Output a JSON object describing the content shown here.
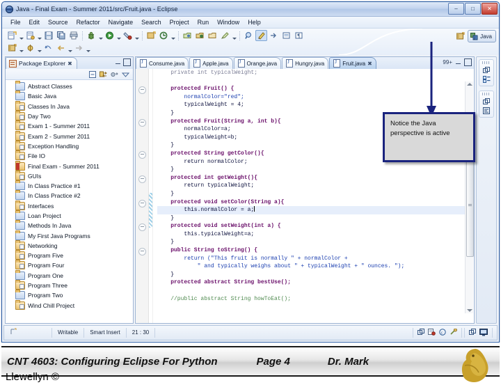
{
  "window": {
    "title": "Java - Final Exam - Summer 2011/src/Fruit.java - Eclipse",
    "logo_icon": "eclipse-logo-icon",
    "minimize_label": "–",
    "maximize_label": "□",
    "close_label": "✕"
  },
  "menubar": [
    {
      "label": "File"
    },
    {
      "label": "Edit"
    },
    {
      "label": "Source"
    },
    {
      "label": "Refactor"
    },
    {
      "label": "Navigate"
    },
    {
      "label": "Search"
    },
    {
      "label": "Project"
    },
    {
      "label": "Run"
    },
    {
      "label": "Window"
    },
    {
      "label": "Help"
    }
  ],
  "toolbar": {
    "row1": [
      {
        "name": "new-wizard-button",
        "glyph": "▤"
      },
      {
        "name": "new-wizard-dropdown",
        "glyph": "caret"
      },
      {
        "name": "new-java-class-button",
        "glyph": "▥"
      },
      {
        "name": "new-java-class-dropdown",
        "glyph": "caret"
      },
      {
        "name": "save-button",
        "glyph": "▣"
      },
      {
        "name": "save-all-button",
        "glyph": "▨"
      },
      {
        "name": "print-button",
        "glyph": "⎙"
      },
      {
        "name": "separator",
        "glyph": "sep"
      },
      {
        "name": "debug-button",
        "glyph": "☢"
      },
      {
        "name": "debug-dropdown",
        "glyph": "caret"
      },
      {
        "name": "run-button",
        "glyph": "▶"
      },
      {
        "name": "run-dropdown",
        "glyph": "caret"
      },
      {
        "name": "run-external-tools-button",
        "glyph": "⚒"
      },
      {
        "name": "run-external-tools-dropdown",
        "glyph": "caret"
      },
      {
        "name": "separator",
        "glyph": "sep"
      },
      {
        "name": "new-package-button",
        "glyph": "◫"
      },
      {
        "name": "open-type-button",
        "glyph": "Ⓖ"
      },
      {
        "name": "open-type-dropdown",
        "glyph": "caret"
      },
      {
        "name": "separator",
        "glyph": "sep"
      },
      {
        "name": "open-task-button",
        "glyph": "◗"
      },
      {
        "name": "new-task-button",
        "glyph": "◖"
      },
      {
        "name": "deactivate-task-button",
        "glyph": "◑"
      },
      {
        "name": "filter-task-button",
        "glyph": "✐"
      },
      {
        "name": "task-dropdown",
        "glyph": "caret"
      },
      {
        "name": "separator",
        "glyph": "sep"
      },
      {
        "name": "search-button",
        "glyph": "⊕"
      },
      {
        "name": "highlight-button",
        "glyph": "✎"
      },
      {
        "name": "next-annotation-button",
        "glyph": "➤"
      },
      {
        "name": "last-edit-button",
        "glyph": "▤"
      },
      {
        "name": "toggle-mark-button",
        "glyph": "¶"
      }
    ],
    "row2": [
      {
        "name": "open-perspective-button",
        "glyph": "⬚"
      },
      {
        "name": "open-perspective-dropdown",
        "glyph": "caret"
      },
      {
        "name": "toggle-breakpoint-button",
        "glyph": "⚲"
      },
      {
        "name": "toggle-breakpoint-dropdown",
        "glyph": "caret"
      },
      {
        "name": "previous-edit-button",
        "glyph": "↶"
      },
      {
        "name": "back-button",
        "glyph": "←"
      },
      {
        "name": "back-dropdown",
        "glyph": "caret"
      },
      {
        "name": "forward-button",
        "glyph": "→"
      },
      {
        "name": "forward-dropdown",
        "glyph": "caret"
      }
    ],
    "perspective": {
      "open_perspective_icon": "open-perspective-icon",
      "active_label": "Java",
      "active_icon": "java-perspective-icon"
    }
  },
  "package_explorer": {
    "title": "Package Explorer",
    "title_icon": "package-explorer-icon",
    "close_icon": "close-icon",
    "minimize_icon": "minimize-icon",
    "maximize_icon": "maximize-icon",
    "view_toolbar": [
      {
        "name": "collapse-all-button",
        "glyph": "⊟"
      },
      {
        "name": "link-with-editor-button",
        "glyph": "⇄"
      },
      {
        "name": "focus-on-active-task-button",
        "glyph": "◔"
      },
      {
        "name": "view-menu-button",
        "glyph": "▽"
      }
    ],
    "items": [
      {
        "label": "Abstract Classes",
        "kind": "project"
      },
      {
        "label": "Basic Java",
        "kind": "project"
      },
      {
        "label": "Classes In Java",
        "kind": "package"
      },
      {
        "label": "Day Two",
        "kind": "package"
      },
      {
        "label": "Exam 1 - Summer 2011",
        "kind": "package"
      },
      {
        "label": "Exam 2 - Summer 2011",
        "kind": "package"
      },
      {
        "label": "Exception Handling",
        "kind": "package"
      },
      {
        "label": "File IO",
        "kind": "package"
      },
      {
        "label": "Final Exam - Summer 2011",
        "kind": "active"
      },
      {
        "label": "GUIs",
        "kind": "package"
      },
      {
        "label": "In Class Practice #1",
        "kind": "project"
      },
      {
        "label": "In Class Practice #2",
        "kind": "project"
      },
      {
        "label": "Interfaces",
        "kind": "package"
      },
      {
        "label": "Loan Project",
        "kind": "project"
      },
      {
        "label": "Methods In Java",
        "kind": "project"
      },
      {
        "label": "My First Java Programs",
        "kind": "project"
      },
      {
        "label": "Networking",
        "kind": "package"
      },
      {
        "label": "Program Five",
        "kind": "package"
      },
      {
        "label": "Program Four",
        "kind": "package"
      },
      {
        "label": "Program One",
        "kind": "project"
      },
      {
        "label": "Program Three",
        "kind": "package"
      },
      {
        "label": "Program Two",
        "kind": "project"
      },
      {
        "label": "Wind Chill Project",
        "kind": "package"
      }
    ]
  },
  "editor": {
    "tabs": [
      {
        "label": "Consume.java",
        "active": false
      },
      {
        "label": "Apple.java",
        "active": false
      },
      {
        "label": "Orange.java",
        "active": false
      },
      {
        "label": "Hungry.java",
        "active": false
      },
      {
        "label": "Fruit.java",
        "active": true
      }
    ],
    "overflow_label": "99+",
    "minimize_icon": "minimize-icon",
    "maximize_icon": "maximize-icon",
    "code_lines": [
      {
        "text": "    private int typicalWeight;",
        "cls": "pln",
        "fold": false,
        "hl": false,
        "clip": true
      },
      {
        "text": "",
        "cls": "pln",
        "fold": false,
        "hl": false
      },
      {
        "text": "    protected Fruit() {",
        "cls": "kw",
        "fold": true,
        "hl": false
      },
      {
        "text": "        normalColor=\"red\";",
        "cls": "str",
        "fold": false,
        "hl": false
      },
      {
        "text": "        typicalWeight = 4;",
        "cls": "pln",
        "fold": false,
        "hl": false
      },
      {
        "text": "    }",
        "cls": "pln",
        "fold": false,
        "hl": false
      },
      {
        "text": "    protected Fruit(String a, int b){",
        "cls": "kw",
        "fold": true,
        "hl": false
      },
      {
        "text": "        normalColor=a;",
        "cls": "pln",
        "fold": false,
        "hl": false
      },
      {
        "text": "        typicalWeight=b;",
        "cls": "pln",
        "fold": false,
        "hl": false
      },
      {
        "text": "    }",
        "cls": "pln",
        "fold": false,
        "hl": false
      },
      {
        "text": "    protected String getColor(){",
        "cls": "kw",
        "fold": true,
        "hl": false
      },
      {
        "text": "        return normalColor;",
        "cls": "pln",
        "fold": false,
        "hl": false
      },
      {
        "text": "    }",
        "cls": "pln",
        "fold": false,
        "hl": false
      },
      {
        "text": "    protected int getWeight(){",
        "cls": "kw",
        "fold": true,
        "hl": false
      },
      {
        "text": "        return typicalWeight;",
        "cls": "pln",
        "fold": false,
        "hl": false
      },
      {
        "text": "    }",
        "cls": "pln",
        "fold": false,
        "hl": false
      },
      {
        "text": "    protected void setColor(String a){",
        "cls": "kw",
        "fold": true,
        "hl": false
      },
      {
        "text": "        this.normalColor = a;",
        "cls": "pln",
        "fold": false,
        "hl": true
      },
      {
        "text": "    }",
        "cls": "pln",
        "fold": false,
        "hl": false
      },
      {
        "text": "    protected void setWeight(int a) {",
        "cls": "kw",
        "fold": true,
        "hl": false
      },
      {
        "text": "        this.typicalWeight=a;",
        "cls": "pln",
        "fold": false,
        "hl": false
      },
      {
        "text": "    }",
        "cls": "pln",
        "fold": false,
        "hl": false
      },
      {
        "text": "    public String toString() {",
        "cls": "kw",
        "fold": true,
        "hl": false
      },
      {
        "text": "        return (\"This fruit is normally \" + normalColor +",
        "cls": "str",
        "fold": false,
        "hl": false
      },
      {
        "text": "            \" and typically weighs about \" + typicalWeight + \" ounces. \");",
        "cls": "str",
        "fold": false,
        "hl": false
      },
      {
        "text": "    }",
        "cls": "pln",
        "fold": false,
        "hl": false
      },
      {
        "text": "    protected abstract String bestUse();",
        "cls": "kw",
        "fold": false,
        "hl": false
      },
      {
        "text": "",
        "cls": "pln",
        "fold": false,
        "hl": false
      },
      {
        "text": "    //public abstract String howToEat();",
        "cls": "cmt",
        "fold": false,
        "hl": false
      }
    ]
  },
  "fast_view_bar": {
    "groups": [
      {
        "icons": [
          {
            "name": "restore-view-icon",
            "glyph": "❐"
          },
          {
            "name": "outline-view-icon",
            "glyph": "▦"
          }
        ]
      },
      {
        "icons": [
          {
            "name": "restore-view-icon",
            "glyph": "❐"
          },
          {
            "name": "task-list-view-icon",
            "glyph": "▤"
          }
        ]
      }
    ]
  },
  "status_bar": {
    "left_icon": "smart-insert-indicator-icon",
    "writable": "Writable",
    "insert_mode": "Smart Insert",
    "cursor_position": "21 : 30",
    "right_icons": [
      {
        "name": "minimize-pane-icon",
        "glyph": "❐"
      },
      {
        "name": "build-status-icon",
        "glyph": "▥"
      },
      {
        "name": "copyright-icon",
        "glyph": "Ⓒ"
      },
      {
        "name": "progress-icon",
        "glyph": "⛏"
      }
    ],
    "right_icons2": [
      {
        "name": "minimize-pane-icon",
        "glyph": "❐"
      },
      {
        "name": "workbench-icon",
        "glyph": "▣"
      }
    ]
  },
  "callout": {
    "text": "Notice the Java perspective is active",
    "border_color": "#1a237e",
    "fill_color": "#d9d9d9",
    "arrow_color": "#1a237e"
  },
  "footer": {
    "course": "CNT 4603: Configuring Eclipse For Python",
    "page": "Page 4",
    "author": "Dr. Mark",
    "author_line2": "Llewellyn ©",
    "logo_icon": "pegasus-logo-icon"
  }
}
